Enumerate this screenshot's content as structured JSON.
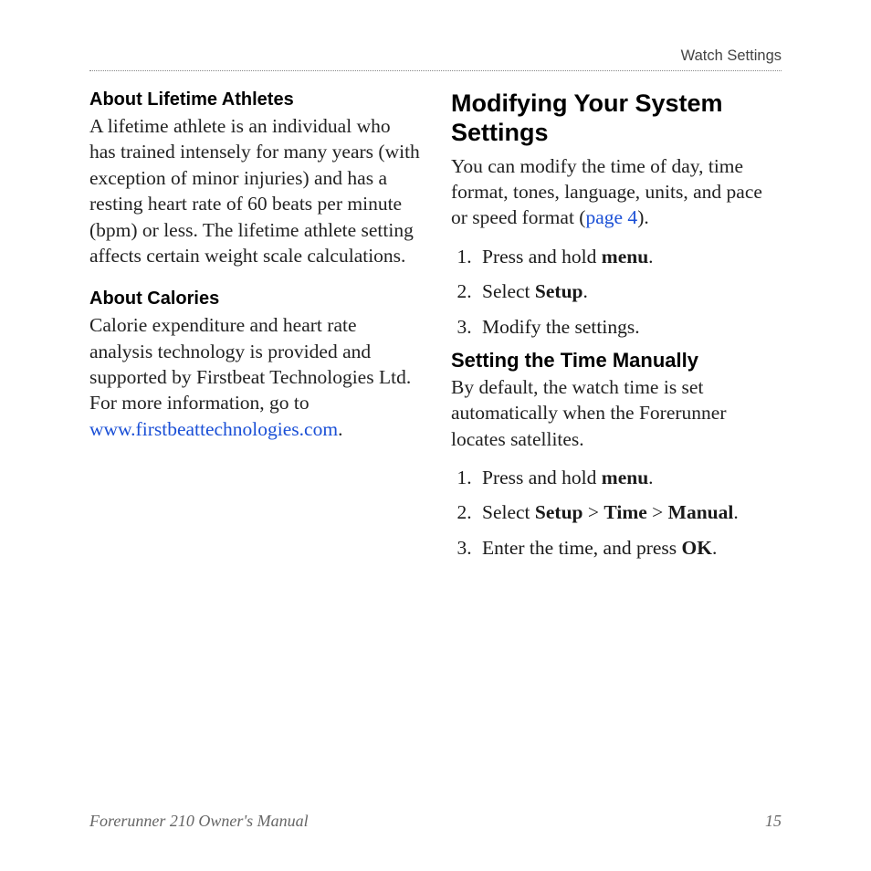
{
  "header": {
    "running_head": "Watch Settings"
  },
  "left": {
    "h_athletes": "About Lifetime Athletes",
    "p_athletes": "A lifetime athlete is an individual who has trained intensely for many years (with exception of minor injuries) and has a resting heart rate of 60 beats per minute (bpm) or less. The lifetime athlete setting affects certain weight scale calculations.",
    "h_calories": "About Calories",
    "p_calories_pre": "Calorie expenditure and heart rate analysis technology is provided and supported by Firstbeat Technologies Ltd. For more information, go to ",
    "p_calories_link": "www.firstbeattechnologies.com",
    "p_calories_post": "."
  },
  "right": {
    "h_main": "Modifying Your System Settings",
    "p_intro_pre": "You can modify the time of day, time format, tones, language, units, and pace or speed format (",
    "p_intro_link": "page 4",
    "p_intro_post": ").",
    "steps_a": {
      "s1_pre": "Press and hold ",
      "s1_b": "menu",
      "s1_post": ".",
      "s2_pre": "Select ",
      "s2_b": "Setup",
      "s2_post": ".",
      "s3": "Modify the settings."
    },
    "h_time": "Setting the Time Manually",
    "p_time": "By default, the watch time is set automatically when the Forerunner locates satellites.",
    "steps_b": {
      "s1_pre": "Press and hold ",
      "s1_b": "menu",
      "s1_post": ".",
      "s2_pre": "Select ",
      "s2_b1": "Setup",
      "s2_sep1": " > ",
      "s2_b2": "Time",
      "s2_sep2": " > ",
      "s2_b3": "Manual",
      "s2_post": ".",
      "s3_pre": "Enter the time, and press ",
      "s3_b": "OK",
      "s3_post": "."
    }
  },
  "footer": {
    "title": "Forerunner 210 Owner's Manual",
    "page": "15"
  }
}
